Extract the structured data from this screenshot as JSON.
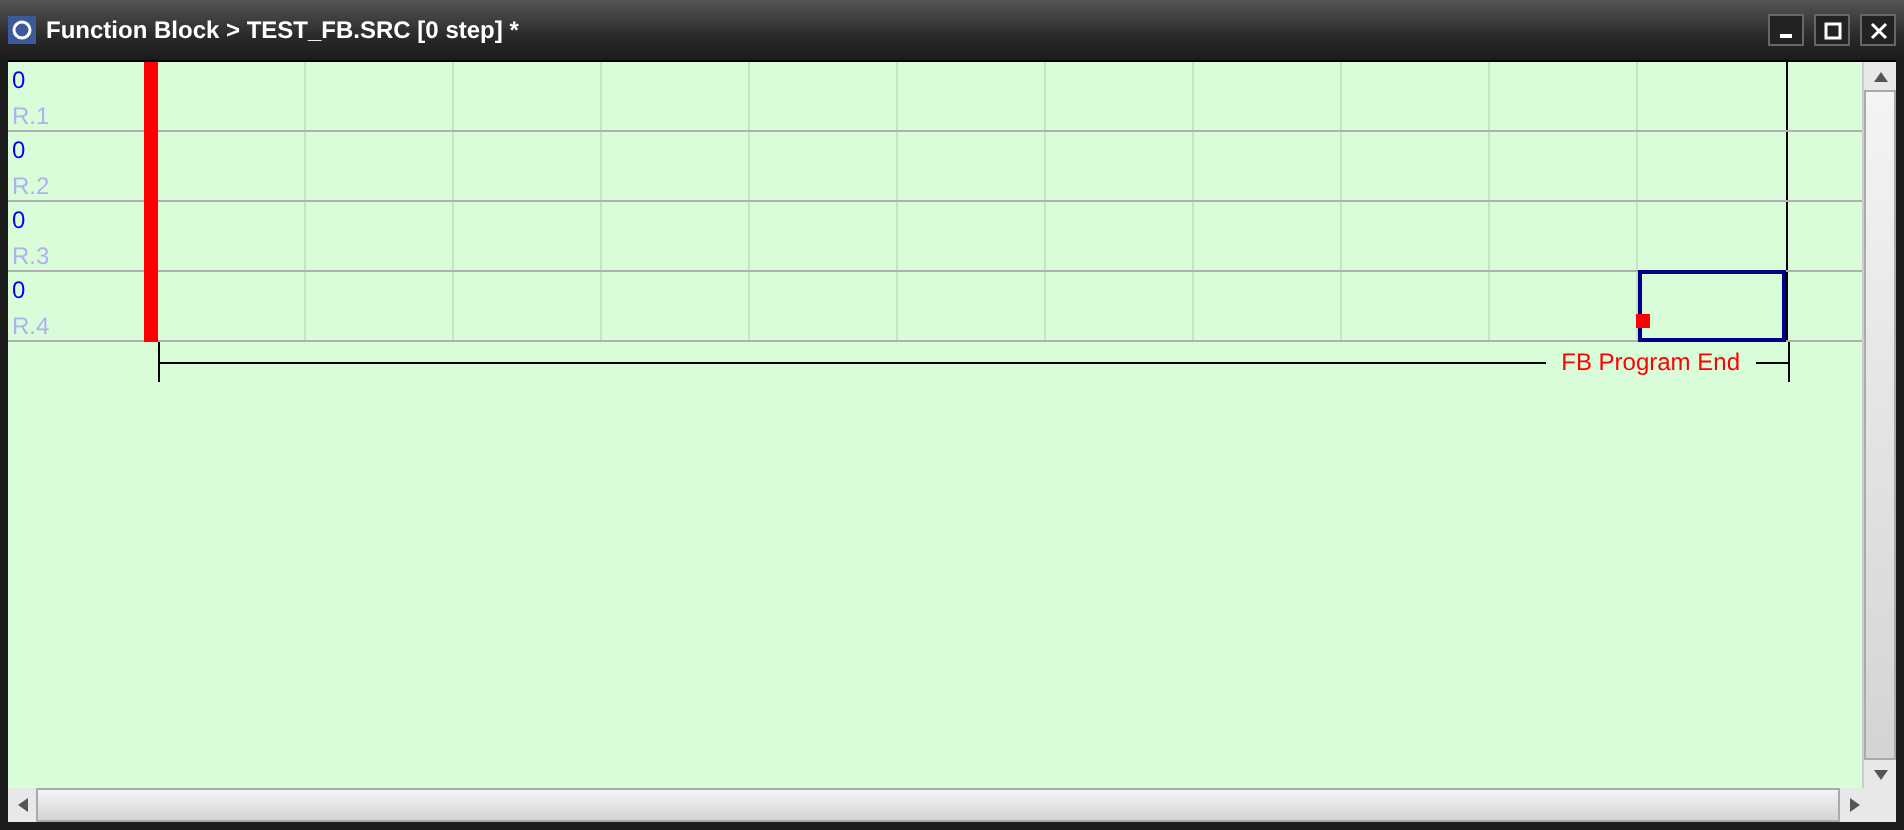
{
  "window": {
    "title": "Function Block > TEST_FB.SRC [0 step] *"
  },
  "rungs": [
    {
      "step": "0",
      "label": "R.1",
      "cursor": false
    },
    {
      "step": "0",
      "label": "R.2",
      "cursor": false
    },
    {
      "step": "0",
      "label": "R.3",
      "cursor": false
    },
    {
      "step": "0",
      "label": "R.4",
      "cursor": true
    }
  ],
  "end_label": "FB Program End"
}
